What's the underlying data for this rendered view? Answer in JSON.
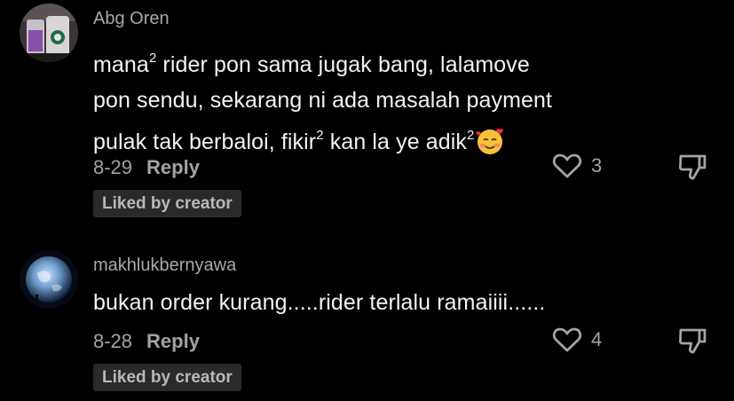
{
  "colors": {
    "background": "#000000",
    "username": "#a9a9a9",
    "body_text": "#f2f2f2",
    "meta_text": "#a3a3a3",
    "badge_bg": "#2a2a2a"
  },
  "comments": [
    {
      "username": "Abg Oren",
      "avatar_icon": "avatar-drinks-photo",
      "lines": [
        {
          "a": "mana",
          "sup": "2",
          "b": " rider pon sama jugak bang, lalamove"
        },
        {
          "a": "pon sendu, sekarang ni ada masalah payment"
        },
        {
          "a": "pulak tak berbaloi, fikir",
          "sup": "2",
          "b": " kan la ye adik",
          "sup2": "2"
        }
      ],
      "emoji": "smiling-face-with-hearts-icon",
      "date": "8-29",
      "reply_label": "Reply",
      "like_count": "3",
      "badge": "Liked by creator"
    },
    {
      "username": "makhlukbernyawa",
      "avatar_icon": "avatar-earth-photo",
      "text": "bukan order kurang.....rider terlalu ramaiiii......",
      "date": "8-28",
      "reply_label": "Reply",
      "like_count": "4",
      "badge": "Liked by creator"
    }
  ]
}
